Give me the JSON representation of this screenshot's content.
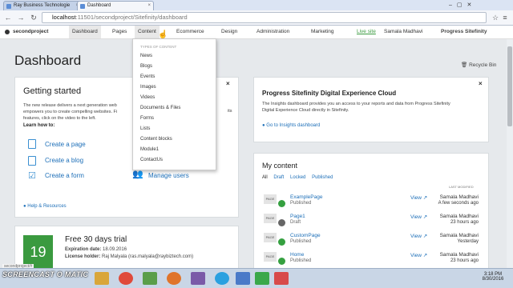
{
  "browser": {
    "tabs": [
      {
        "label": "Ray Business Technologie"
      },
      {
        "label": "Dashboard"
      }
    ],
    "url_host": "localhost",
    "url_rest": ":11501/secondproject/Sitefinity/dashboard"
  },
  "topnav": {
    "project": "secondproject",
    "items": [
      "Dashboard",
      "Pages",
      "Content",
      "Ecommerce",
      "Design",
      "Administration",
      "Marketing"
    ],
    "live_site": "Live site",
    "user": "Samala Madhavi",
    "brand": "Progress Sitefinity"
  },
  "dropdown": {
    "header": "TYPES OF CONTENT",
    "items": [
      "News",
      "Blogs",
      "Events",
      "Images",
      "Videos",
      "Documents & Files",
      "Forms",
      "Lists",
      "Content blocks",
      "Module1",
      "ContactUs"
    ]
  },
  "page": {
    "title": "Dashboard",
    "recycle_bin": "Recycle Bin"
  },
  "getting_started": {
    "title": "Getting started",
    "desc_line1": "The new release delivers a next generation web",
    "desc_line2": "empowers you to create compelling websites. Fi",
    "desc_line3": "features, click on the video to the left.",
    "desc_tail": "its",
    "learn": "Learn how to:",
    "create_page": "Create a page",
    "create_blog": "Create a blog",
    "create_form": "Create a form",
    "manage_users": "Manage users",
    "help": "Help & Resources"
  },
  "dec_card": {
    "title": "Progress Sitefinity Digital Experience Cloud",
    "desc_line1": "The Insights dashboard provides you an access to your reports and data from Progress Sitefinity",
    "desc_line2": "Digital Experience Cloud directly in Sitefinity.",
    "link": "Go to Insights dashboard"
  },
  "my_content": {
    "title": "My content",
    "filters": [
      "All",
      "Draft",
      "Locked",
      "Published"
    ],
    "last_modified": "LAST MODIFIED",
    "badge": "PAGE",
    "view": "View",
    "rows": [
      {
        "name": "ExamplePage",
        "status": "Published",
        "author": "Samala Madhavi",
        "time": "A few seconds ago"
      },
      {
        "name": "Page1",
        "status": "Draft",
        "author": "Samala Madhavi",
        "time": "23 hours ago"
      },
      {
        "name": "CustomPage",
        "status": "Published",
        "author": "Samala Madhavi",
        "time": "Yesterday"
      },
      {
        "name": "Home",
        "status": "Published",
        "author": "Samala Madhavi",
        "time": "23 hours ago"
      }
    ]
  },
  "trial": {
    "days": "19",
    "title": "Free 30 days trial",
    "expiration_label": "Expiration date:",
    "expiration": "18.09.2016",
    "license_label": "License holder:",
    "license": "Raj Malyala (ras.malyala@raybiztech.com)"
  },
  "statusbar": "secondproject/#",
  "watermark": "SCREENCAST O MATIC",
  "taskbar": {
    "time": "3:18 PM",
    "date": "8/30/2016"
  },
  "colors": {
    "link": "#1d6fb8",
    "trial_green": "#3a9a3f",
    "published": "#35a040"
  }
}
